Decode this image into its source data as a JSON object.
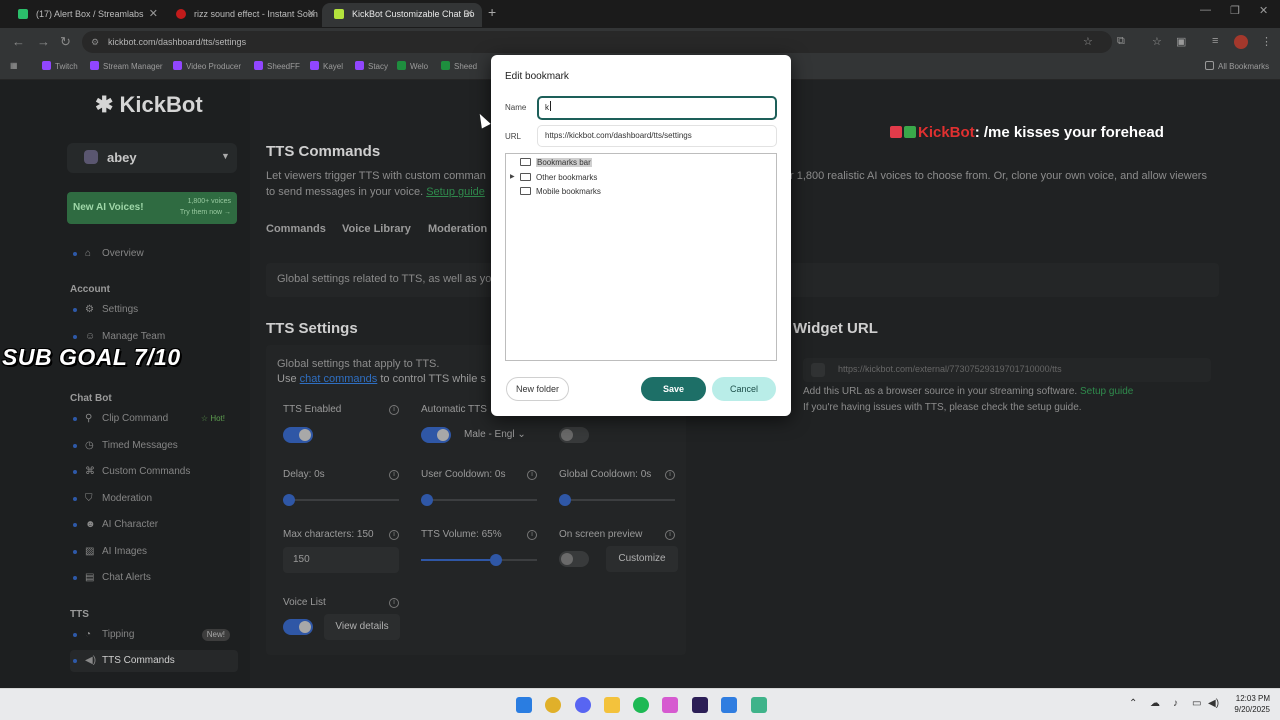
{
  "browser": {
    "tabs": [
      {
        "title": "(17) Alert Box / Streamlabs",
        "favicon_color": "#2bbf6b"
      },
      {
        "title": "rizz sound effect - Instant Soun",
        "favicon_color": "#c21b1b"
      },
      {
        "title": "KickBot Customizable Chat Bo",
        "favicon_color": "#b4e33d"
      }
    ],
    "url": "kickbot.com/dashboard/tts/settings",
    "bookmarks": [
      {
        "label": "Twitch",
        "color": "#9146ff"
      },
      {
        "label": "Stream Manager",
        "color": "#9146ff"
      },
      {
        "label": "Video Producer",
        "color": "#9146ff"
      },
      {
        "label": "SheedFF",
        "color": "#9146ff"
      },
      {
        "label": "Kayel",
        "color": "#9146ff"
      },
      {
        "label": "Stacy",
        "color": "#9146ff"
      },
      {
        "label": "Welo",
        "color": "#1e8e3e"
      },
      {
        "label": "Sheed",
        "color": "#1e8e3e"
      }
    ],
    "all_bookmarks": "All Bookmarks"
  },
  "sidebar": {
    "logo": "KickBot",
    "username": "abey",
    "promo": {
      "title": "New AI Voices!",
      "line1": "1,800+ voices",
      "line2": "Try them now →"
    },
    "overview": "Overview",
    "account_header": "Account",
    "settings": "Settings",
    "manage_team": "Manage Team",
    "chatbot_header": "Chat Bot",
    "clip_command": "Clip Command",
    "hot_badge": "☆ Hot!",
    "timed_messages": "Timed Messages",
    "custom_commands": "Custom Commands",
    "moderation": "Moderation",
    "ai_character": "AI Character",
    "ai_images": "AI Images",
    "chat_alerts": "Chat Alerts",
    "tts_header": "TTS",
    "tipping": "Tipping",
    "new_badge": "New!",
    "tts_commands": "TTS Commands"
  },
  "main": {
    "title": "TTS Commands",
    "intro_line1_a": "Let viewers trigger TTS with custom comman",
    "intro_line1_b": "r 1,800 realistic AI voices to choose from. Or, clone your own voice, and allow viewers",
    "intro_line2": "to send messages in your voice.",
    "setup_guide": "Setup guide",
    "tabs": [
      "Commands",
      "Voice Library",
      "Moderation"
    ],
    "global_bar": "Global settings related to TTS, as well as yo",
    "tts_settings_title": "TTS Settings",
    "tts_settings_desc": "Global settings that apply to TTS.",
    "use_prefix": "Use",
    "chat_commands_link": "chat commands",
    "use_suffix": "to control TTS while s",
    "tts_enabled": "TTS Enabled",
    "automatic_tts": "Automatic TTS",
    "voice_select": "Male - Engl",
    "delay": "Delay: 0s",
    "user_cooldown": "User Cooldown: 0s",
    "global_cooldown": "Global Cooldown: 0s",
    "max_characters": "Max characters: 150",
    "max_characters_value": "150",
    "tts_volume": "TTS Volume: 65%",
    "tts_volume_level": 0.65,
    "on_screen_preview": "On screen preview",
    "customize": "Customize",
    "voice_list": "Voice List",
    "view_details": "View details",
    "widget_title": "Widget URL",
    "widget_url": "https://kickbot.com/external/77307529319701710000/tts",
    "widget_desc_a": "Add this URL as a browser source in your streaming software.",
    "widget_setup_guide": "Setup guide",
    "widget_desc_b": "If you're having issues with TTS, please check the setup guide."
  },
  "overlay": {
    "brand": "KickBot",
    "message": ": /me kisses your forehead",
    "sub_goal": "SUB GOAL 7/10"
  },
  "dialog": {
    "title": "Edit bookmark",
    "name_label": "Name",
    "name_value": "k",
    "url_label": "URL",
    "url_value": "https://kickbot.com/dashboard/tts/settings",
    "folders": [
      "Bookmarks bar",
      "Other bookmarks",
      "Mobile bookmarks"
    ],
    "new_folder": "New folder",
    "save": "Save",
    "cancel": "Cancel"
  },
  "taskbar": {
    "time": "12:03 PM",
    "date": "9/20/2025"
  }
}
